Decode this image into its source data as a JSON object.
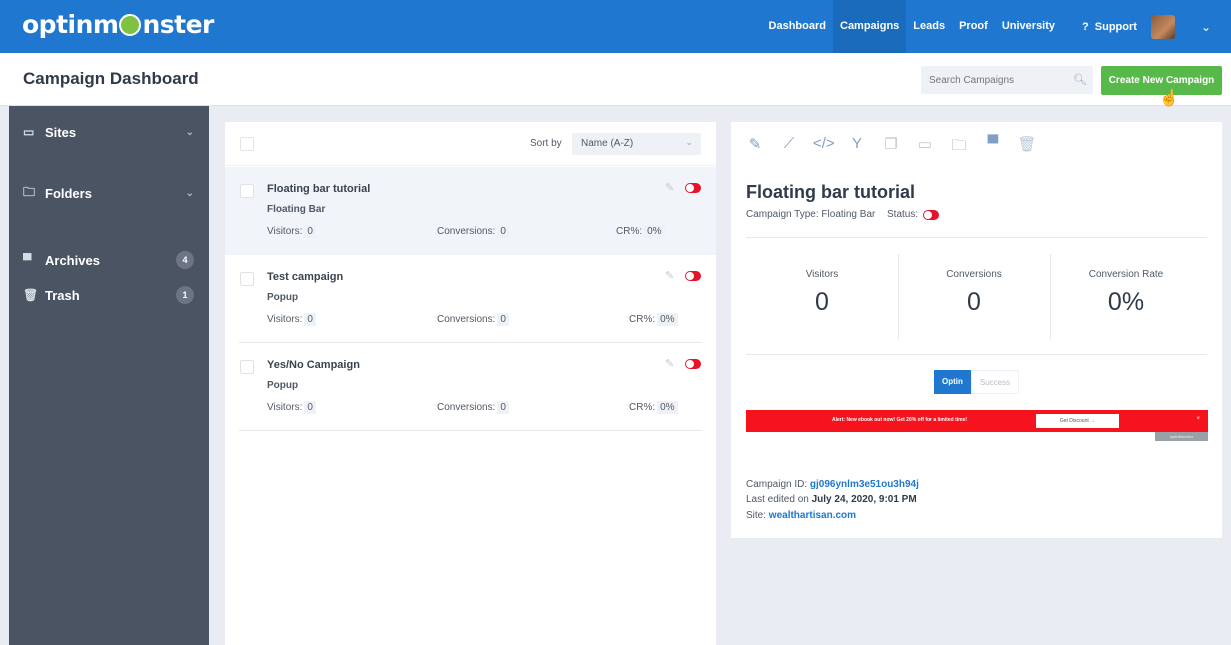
{
  "app": {
    "logo": {
      "before": "optinm",
      "after": "nster"
    }
  },
  "nav": {
    "items": [
      "Dashboard",
      "Campaigns",
      "Leads",
      "Proof",
      "University"
    ],
    "active": "Campaigns",
    "support": "Support"
  },
  "header": {
    "title": "Campaign Dashboard",
    "search_placeholder": "Search Campaigns",
    "create_label": "Create New Campaign"
  },
  "sidebar": {
    "items": [
      {
        "label": "Sites",
        "icon": "window-icon"
      },
      {
        "label": "Folders",
        "icon": "folder-icon"
      },
      {
        "label": "Archives",
        "icon": "archive-icon",
        "count": "4"
      },
      {
        "label": "Trash",
        "icon": "trash-icon",
        "count": "1"
      }
    ]
  },
  "list": {
    "sort_label": "Sort by",
    "sort_value": "Name (A-Z)",
    "stat_labels": {
      "visitors": "Visitors:",
      "conversions": "Conversions:",
      "cr": "CR%:"
    },
    "campaigns": [
      {
        "title": "Floating bar tutorial",
        "type": "Floating Bar",
        "visitors": "0",
        "conversions": "0",
        "cr": "0%",
        "selected": true
      },
      {
        "title": "Test campaign",
        "type": "Popup",
        "visitors": "0",
        "conversions": "0",
        "cr": "0%",
        "selected": false
      },
      {
        "title": "Yes/No Campaign",
        "type": "Popup",
        "visitors": "0",
        "conversions": "0",
        "cr": "0%",
        "selected": false
      }
    ]
  },
  "detail": {
    "title": "Floating bar tutorial",
    "type_label": "Campaign Type:",
    "type_value": "Floating Bar",
    "status_label": "Status:",
    "metrics": [
      {
        "label": "Visitors",
        "value": "0"
      },
      {
        "label": "Conversions",
        "value": "0"
      },
      {
        "label": "Conversion Rate",
        "value": "0%"
      }
    ],
    "views": [
      "Optin",
      "Success"
    ],
    "active_view": "Optin",
    "preview": {
      "alert_text": "Alert: New ebook out now! Get 20% off for a limited time!",
      "button_text": "Get Discount →",
      "tab_text": "optinMonster"
    },
    "campaign_id_label": "Campaign ID:",
    "campaign_id": "gj096ynlm3e51ou3h94j",
    "last_edited_label": "Last edited on",
    "last_edited": "July 24, 2020, 9:01 PM",
    "site_label": "Site:",
    "site": "wealthartisan.com"
  },
  "colors": {
    "topbar": "#1f77cf",
    "accent_green": "#57b949",
    "toggle_red": "#e8122a",
    "sidebar_bg": "#4a5463"
  }
}
